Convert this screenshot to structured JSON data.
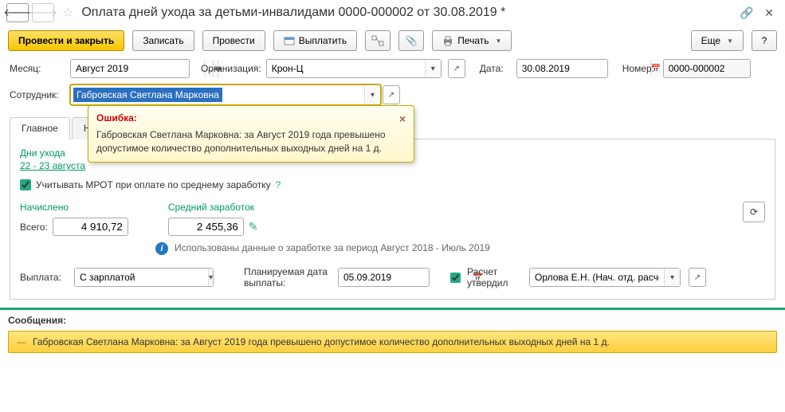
{
  "header": {
    "title": "Оплата дней ухода за детьми-инвалидами 0000-000002 от 30.08.2019 *"
  },
  "toolbar": {
    "post_close": "Провести и закрыть",
    "save": "Записать",
    "post": "Провести",
    "pay": "Выплатить",
    "print": "Печать",
    "more": "Еще"
  },
  "form": {
    "month_label": "Месяц:",
    "month_value": "Август 2019",
    "org_label": "Организация:",
    "org_value": "Крон-Ц",
    "date_label": "Дата:",
    "date_value": "30.08.2019",
    "number_label": "Номер:",
    "number_value": "0000-000002",
    "employee_label": "Сотрудник:",
    "employee_value": "Габровская Светлана Марковна"
  },
  "error": {
    "title": "Ошибка:",
    "body": "Габровская Светлана Марковна: за Август 2019 года превышено допустимое количество дополнительных выходных дней на 1 д."
  },
  "tabs": {
    "main": "Главное",
    "accruals": "Начи"
  },
  "main_tab": {
    "care_days_label": "Дни ухода",
    "care_days_link": "22 - 23 августа",
    "mrot_label": "Учитывать МРОТ при оплате по среднему заработку",
    "accrued_label": "Начислено",
    "total_label": "Всего:",
    "total_value": "4 910,72",
    "avg_label": "Средний заработок",
    "avg_value": "2 455,36",
    "info_text": "Использованы данные о заработке за период Август 2018 - Июль 2019",
    "payout_label": "Выплата:",
    "payout_value": "С зарплатой",
    "planned_date_label": "Планируемая дата выплаты:",
    "planned_date_value": "05.09.2019",
    "approved_label": "Расчет утвердил",
    "approver_value": "Орлова Е.Н. (Нач. отд. расчет"
  },
  "messages": {
    "title": "Сообщения:",
    "msg1": "Габровская Светлана Марковна: за Август 2019 года превышено допустимое количество дополнительных выходных дней на 1 д."
  }
}
